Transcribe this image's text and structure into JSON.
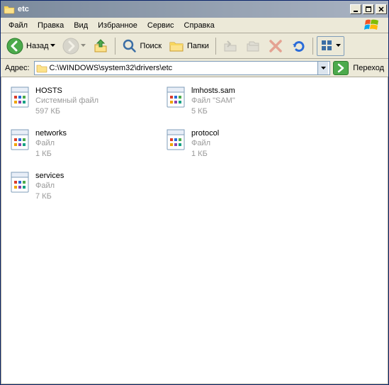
{
  "window": {
    "title": "etc"
  },
  "menu": {
    "file": "Файл",
    "edit": "Правка",
    "view": "Вид",
    "favorites": "Избранное",
    "tools": "Сервис",
    "help": "Справка"
  },
  "toolbar": {
    "back": "Назад",
    "search": "Поиск",
    "folders": "Папки"
  },
  "address": {
    "label": "Адрес:",
    "path": "C:\\WINDOWS\\system32\\drivers\\etc",
    "go": "Переход"
  },
  "files": [
    {
      "name": "HOSTS",
      "type": "Системный файл",
      "size": "597 КБ"
    },
    {
      "name": "lmhosts.sam",
      "type": "Файл \"SAM\"",
      "size": "5 КБ"
    },
    {
      "name": "networks",
      "type": "Файл",
      "size": "1 КБ"
    },
    {
      "name": "protocol",
      "type": "Файл",
      "size": "1 КБ"
    },
    {
      "name": "services",
      "type": "Файл",
      "size": "7 КБ"
    }
  ]
}
